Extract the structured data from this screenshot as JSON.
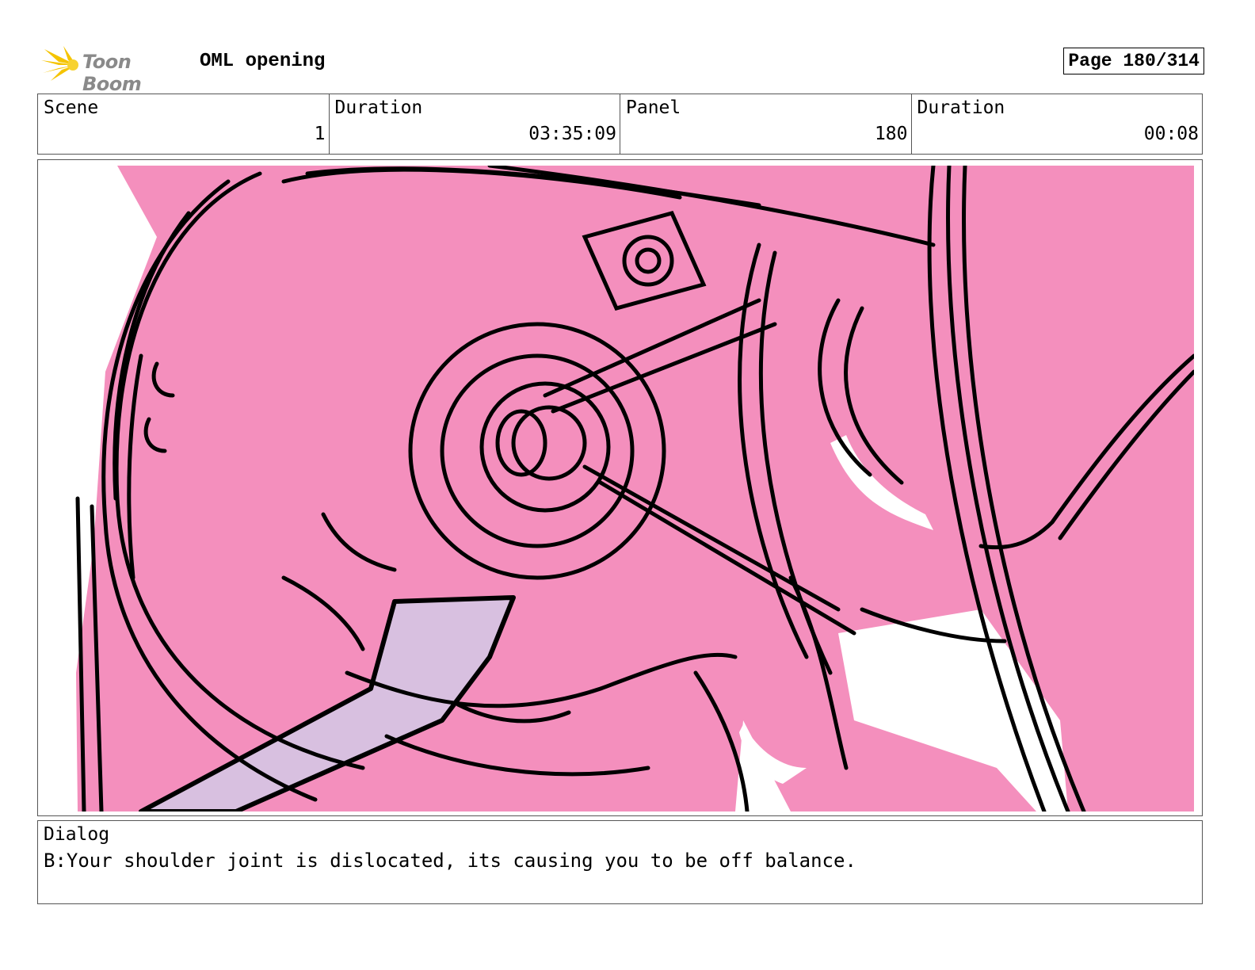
{
  "header": {
    "logo_text": "Toon Boom",
    "title": "OML opening",
    "page": "Page 180/314"
  },
  "info": {
    "scene_label": "Scene",
    "scene_value": "1",
    "duration_label": "Duration",
    "duration_value": "03:35:09",
    "panel_label": "Panel",
    "panel_value": "180",
    "panel_duration_label": "Duration",
    "panel_duration_value": "00:08"
  },
  "colors": {
    "background_pink": "#f48fbd",
    "wrench_lavender": "#d8c0e0",
    "line": "#000000",
    "logo_star": "#f5c400"
  },
  "dialog": {
    "label": "Dialog",
    "text": "B:Your shoulder joint is dislocated, its causing you to be off balance."
  }
}
